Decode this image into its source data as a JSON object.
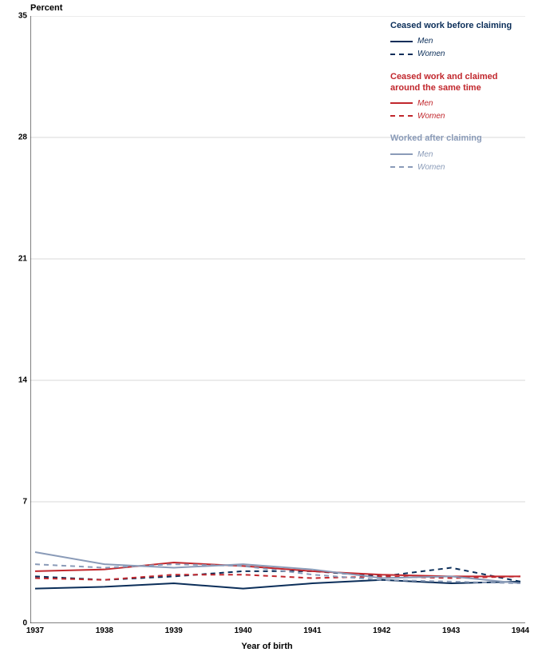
{
  "chart_data": {
    "type": "line",
    "title": null,
    "ylabel": "Percent",
    "xlabel": "Year of birth",
    "ylim": [
      0,
      35
    ],
    "y_ticks": [
      0,
      7,
      14,
      21,
      28,
      35
    ],
    "categories": [
      1937,
      1938,
      1939,
      1940,
      1941,
      1942,
      1943,
      1944
    ],
    "groups": [
      {
        "name": "Ceased work before claiming",
        "color": "#0b2e59",
        "series": [
          {
            "name": "Men",
            "style": "solid",
            "values": [
              2.0,
              2.1,
              2.3,
              2.0,
              2.3,
              2.5,
              2.3,
              2.4
            ]
          },
          {
            "name": "Women",
            "style": "dashed",
            "values": [
              2.7,
              2.5,
              2.7,
              3.0,
              3.0,
              2.7,
              3.2,
              2.4
            ]
          }
        ]
      },
      {
        "name": "Ceased work and claimed around the same time",
        "color": "#c1272d",
        "series": [
          {
            "name": "Men",
            "style": "solid",
            "values": [
              3.0,
              3.1,
              3.5,
              3.3,
              3.0,
              2.8,
              2.7,
              2.7
            ]
          },
          {
            "name": "Women",
            "style": "dashed",
            "values": [
              2.6,
              2.5,
              2.8,
              2.8,
              2.6,
              2.7,
              2.6,
              2.7
            ]
          }
        ]
      },
      {
        "name": "Worked after claiming",
        "color": "#8a9bb8",
        "series": [
          {
            "name": "Men",
            "style": "solid",
            "values": [
              4.1,
              3.4,
              3.2,
              3.4,
              3.1,
              2.6,
              2.7,
              2.3
            ]
          },
          {
            "name": "Women",
            "style": "dashed",
            "values": [
              3.4,
              3.2,
              3.4,
              3.3,
              2.8,
              2.5,
              2.4,
              2.3
            ]
          }
        ]
      }
    ],
    "legend_labels": {
      "men": "Men",
      "women": "Women"
    }
  }
}
